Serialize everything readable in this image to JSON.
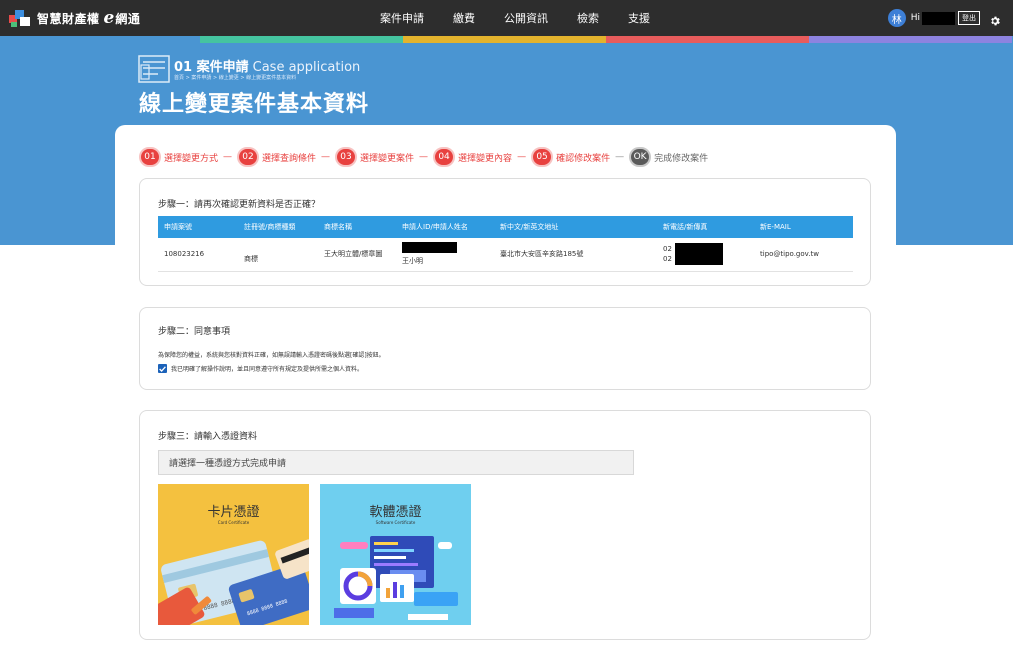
{
  "header": {
    "logo_text": "智慧財產權",
    "logo_e": "e",
    "logo_suffix": "網通",
    "nav": [
      "案件申請",
      "繳費",
      "公開資訊",
      "檢索",
      "支援"
    ],
    "user_avatar": "林",
    "user_hi": "Hi",
    "logout_label": "登出"
  },
  "colorbar": [
    "#45c4a0",
    "#e3b32d",
    "#e85c5c",
    "#8d83e0"
  ],
  "hero": {
    "section_no": "01 案件申請",
    "section_en": "Case application",
    "breadcrumb": "首頁 > 案件申請 > 線上變更 > 線上變更案件基本資料",
    "title": "線上變更案件基本資料"
  },
  "steps": [
    {
      "num": "01",
      "label": "選擇變更方式"
    },
    {
      "num": "02",
      "label": "選擇查詢條件"
    },
    {
      "num": "03",
      "label": "選擇變更案件"
    },
    {
      "num": "04",
      "label": "選擇變更內容"
    },
    {
      "num": "05",
      "label": "確認修改案件"
    },
    {
      "num": "OK",
      "label": "完成修改案件"
    }
  ],
  "step_sep": "—",
  "step1": {
    "title": "步驟一：請再次確認更新資料是否正確？",
    "headers": [
      "申請案號",
      "註冊號/商標種類",
      "商標名稱",
      "申請人ID/申請人姓名",
      "新中文/新英文地址",
      "新電話/新傳真",
      "新E-MAIL"
    ],
    "row": {
      "case_no": "108023216",
      "type": "商標",
      "name": "王大明立體/標章圖",
      "applicant_name": "王小明",
      "address": "臺北市大安區辛亥路185號",
      "phone_prefix": "02",
      "fax_prefix": "02",
      "email": "tipo@tipo.gov.tw"
    }
  },
  "step2": {
    "title": "步驟二：同意事項",
    "notice": "為保障您的權益，系統與您核對資料正確，如無誤請輸入憑證密碼後點選[確認]按鈕。",
    "agree": "我已明確了解操作說明，並且同意遵守所有規定及提供所需之個人資料。"
  },
  "step3": {
    "title": "步驟三：請輸入憑證資料",
    "select_text": "請選擇一種憑證方式完成申請",
    "card_cert": {
      "title": "卡片憑證",
      "sub": "Card Certificate"
    },
    "soft_cert": {
      "title": "軟體憑證",
      "sub": "Software Certificate"
    }
  },
  "colors": {
    "header_bg": "#2d2d2d",
    "hero_bg": "#4a95d2",
    "step_red": "#e8413f",
    "table_head": "#2f9be0",
    "card_yellow": "#f4c13f",
    "card_cyan": "#6fcfef"
  }
}
